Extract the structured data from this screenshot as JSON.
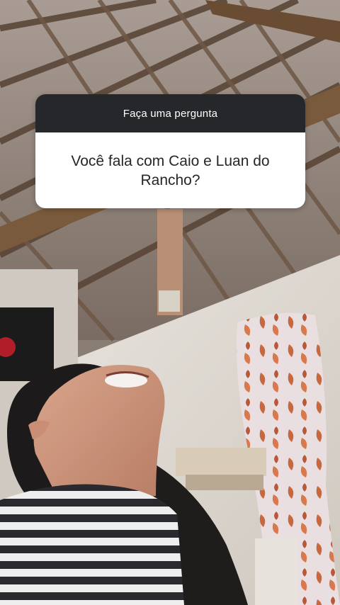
{
  "question_sticker": {
    "prompt": "Faça uma pergunta",
    "question": "Você fala com Caio e Luan do Rancho?"
  },
  "colors": {
    "sticker_header_bg": "#25272a",
    "sticker_body_bg": "#ffffff",
    "sticker_text": "#262626"
  }
}
